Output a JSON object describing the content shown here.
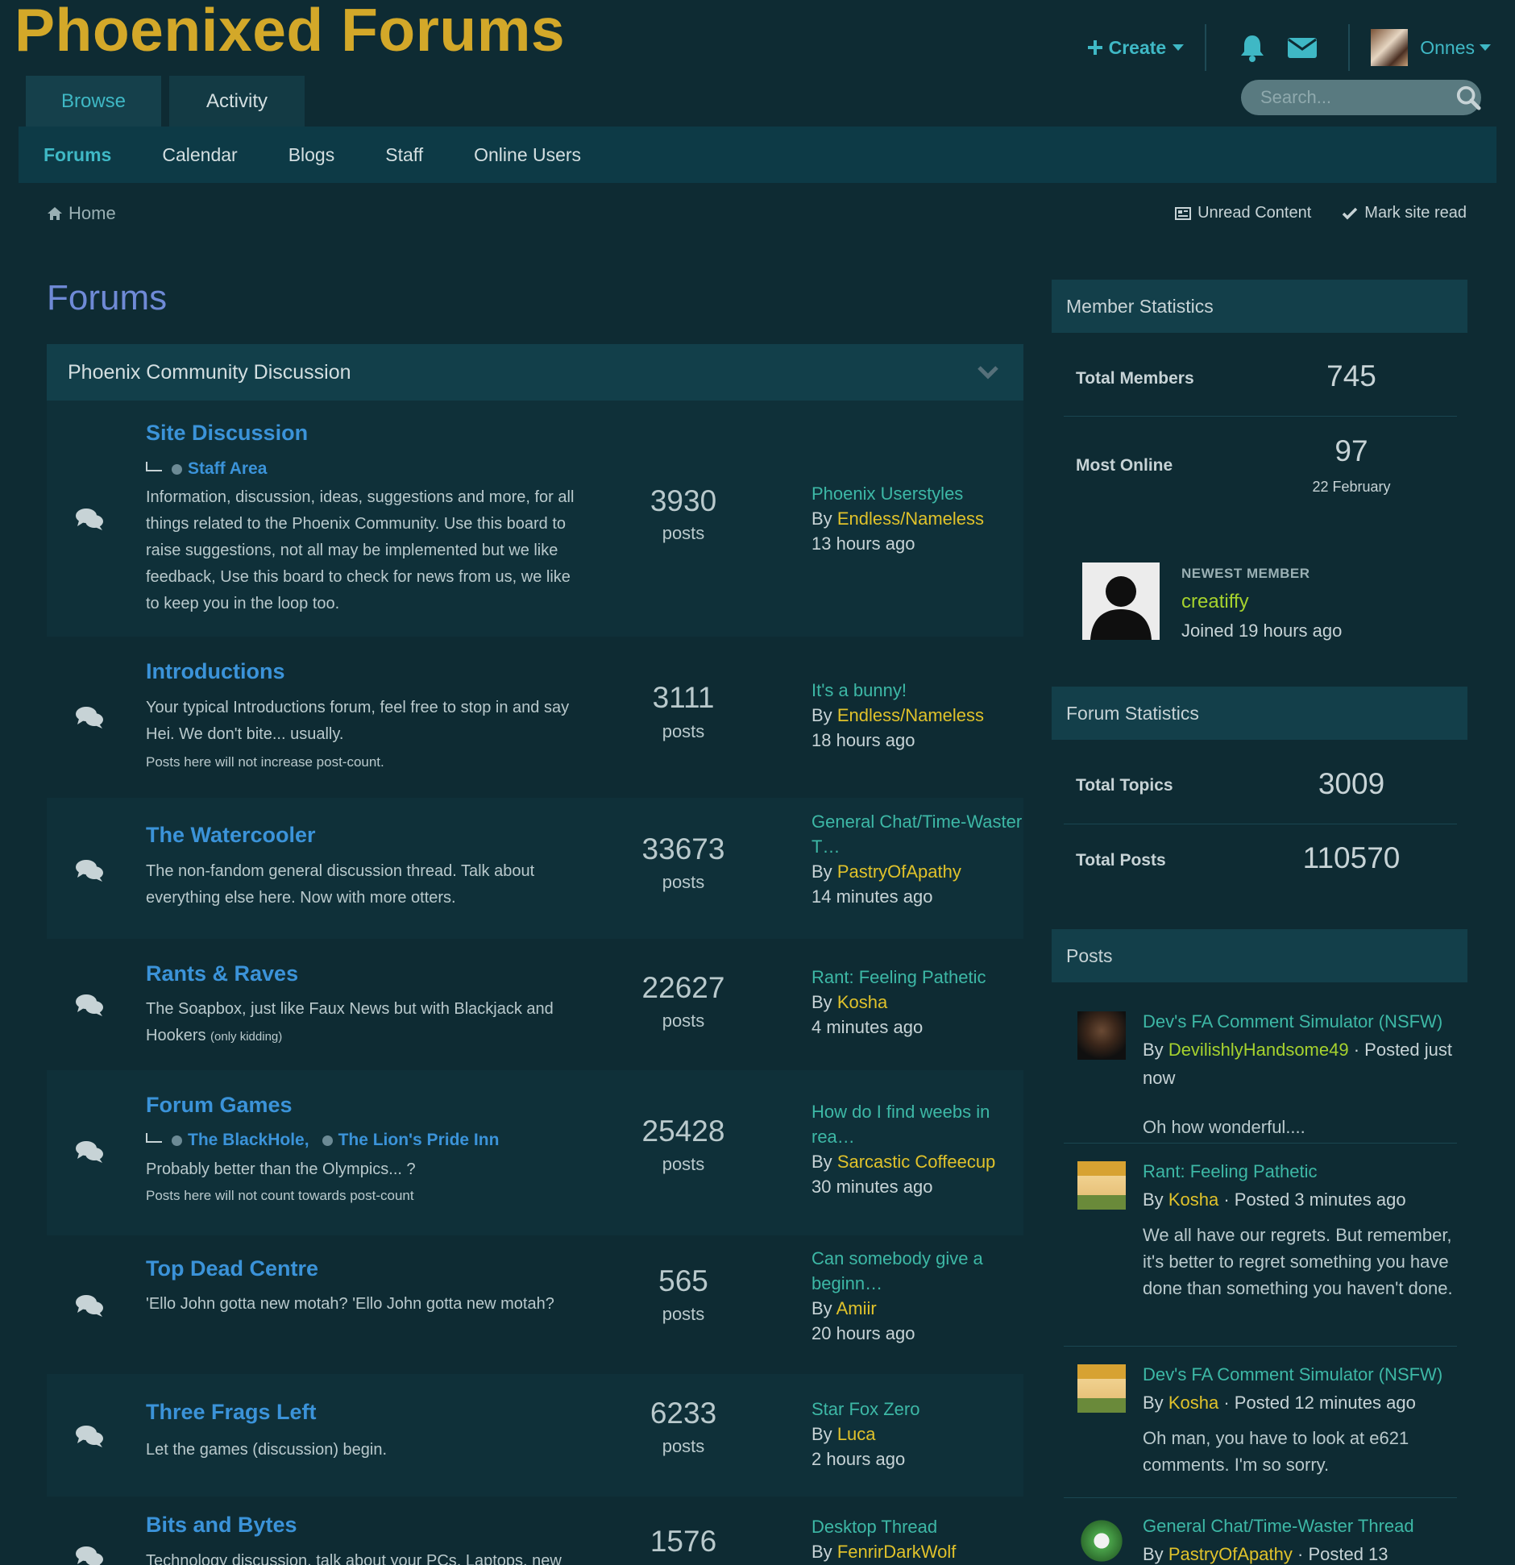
{
  "header": {
    "site_title": "Phoenixed Forums",
    "create_label": "Create",
    "username": "Onnes"
  },
  "main_tabs": [
    {
      "label": "Browse"
    },
    {
      "label": "Activity"
    }
  ],
  "search": {
    "placeholder": "Search..."
  },
  "sub_nav": [
    {
      "label": "Forums"
    },
    {
      "label": "Calendar"
    },
    {
      "label": "Blogs"
    },
    {
      "label": "Staff"
    },
    {
      "label": "Online Users"
    }
  ],
  "breadcrumb": {
    "home": "Home"
  },
  "page_actions": {
    "unread": "Unread Content",
    "mark_read": "Mark site read"
  },
  "page_title": "Forums",
  "category": {
    "title": "Phoenix Community Discussion"
  },
  "forums": [
    {
      "title": "Site Discussion",
      "subforums": [
        "Staff Area"
      ],
      "description": "Information, discussion, ideas, suggestions and more, for all things related to the Phoenix Community. Use this board to raise suggestions, not all may be implemented but we like feedback, Use this board to check for news from us, we like to keep you in the loop too.",
      "count": "3930",
      "count_label": "posts",
      "last_topic": "Phoenix Userstyles",
      "by": "By",
      "last_user": "Endless/Nameless",
      "last_time": "13 hours ago"
    },
    {
      "title": "Introductions",
      "description": "Your typical Introductions forum, feel free to stop in and say Hei. We don't bite... usually.",
      "note": "Posts here will not increase post-count.",
      "count": "3111",
      "count_label": "posts",
      "last_topic": "It's a bunny!",
      "by": "By",
      "last_user": "Endless/Nameless",
      "last_time": "18 hours ago"
    },
    {
      "title": "The Watercooler",
      "description": "The non-fandom general discussion thread. Talk about everything else here. Now with more otters.",
      "count": "33673",
      "count_label": "posts",
      "last_topic": "General Chat/Time-Waster T…",
      "by": "By",
      "last_user": "PastryOfApathy",
      "last_time": "14 minutes ago"
    },
    {
      "title": "Rants & Raves",
      "description": "The Soapbox, just like Faux News but with Blackjack and Hookers",
      "description_small": "(only kidding)",
      "count": "22627",
      "count_label": "posts",
      "last_topic": "Rant: Feeling Pathetic",
      "by": "By",
      "last_user": "Kosha",
      "last_time": "4 minutes ago"
    },
    {
      "title": "Forum Games",
      "subforums": [
        "The BlackHole,",
        "The Lion's Pride Inn"
      ],
      "description": "Probably better than the Olympics... ?",
      "note": "Posts here will not count towards post-count",
      "count": "25428",
      "count_label": "posts",
      "last_topic": "How do I find weebs in rea…",
      "by": "By",
      "last_user": "Sarcastic Coffeecup",
      "last_time": "30 minutes ago"
    },
    {
      "title": "Top Dead Centre",
      "description": "'Ello John gotta new motah? 'Ello John gotta new motah?",
      "count": "565",
      "count_label": "posts",
      "last_topic": "Can somebody give a beginn…",
      "by": "By",
      "last_user": "Amiir",
      "last_time": "20 hours ago"
    },
    {
      "title": "Three Frags Left",
      "description": "Let the games (discussion) begin.",
      "count": "6233",
      "count_label": "posts",
      "last_topic": "Star Fox Zero",
      "by": "By",
      "last_user": "Luca",
      "last_time": "2 hours ago"
    },
    {
      "title": "Bits and Bytes",
      "description": "Technology discussion, talk about your PCs, Laptops, new",
      "count": "1576",
      "count_label": "posts",
      "last_topic": "Desktop Thread",
      "by": "By",
      "last_user": "FenrirDarkWolf",
      "last_time": ""
    }
  ],
  "member_stats": {
    "title": "Member Statistics",
    "total_members_label": "Total Members",
    "total_members": "745",
    "most_online_label": "Most Online",
    "most_online": "97",
    "most_online_date": "22 February",
    "newest_label": "NEWEST MEMBER",
    "newest_name": "creatiffy",
    "newest_joined": "Joined 19 hours ago"
  },
  "forum_stats": {
    "title": "Forum Statistics",
    "topics_label": "Total Topics",
    "topics": "3009",
    "posts_label": "Total Posts",
    "posts": "110570"
  },
  "posts_widget": {
    "title": "Posts",
    "items": [
      {
        "topic": "Dev's FA Comment Simulator (NSFW)",
        "by": "By",
        "user": "DevilishlyHandsome49",
        "meta": "· Posted just now",
        "excerpt": "Oh how wonderful...."
      },
      {
        "topic": "Rant: Feeling Pathetic",
        "by": "By",
        "user": "Kosha",
        "meta": "· Posted 3 minutes ago",
        "excerpt": "We all have our regrets. But remember, it's better to regret something you have done than something you haven't done."
      },
      {
        "topic": "Dev's FA Comment Simulator (NSFW)",
        "by": "By",
        "user": "Kosha",
        "meta": "· Posted 12 minutes ago",
        "excerpt": "Oh man, you have to look at e621 comments. I'm so sorry."
      },
      {
        "topic": "General Chat/Time-Waster Thread",
        "by": "By",
        "user": "PastryOfApathy",
        "meta": "· Posted 13",
        "excerpt": ""
      }
    ]
  },
  "colors": {
    "background": "#0e2b33",
    "title_gold": "#d3a829",
    "accent_teal": "#3fb8c5",
    "forum_link_blue": "#3b93d9",
    "topic_link": "#3db8a6",
    "user_link": "#e0c22b",
    "page_title": "#6f8ad6"
  },
  "icons": [
    "plus-icon",
    "bell-icon",
    "envelope-icon",
    "search-icon",
    "home-icon",
    "newspaper-icon",
    "checkmark-icon",
    "chevron-down-icon",
    "comments-icon"
  ]
}
